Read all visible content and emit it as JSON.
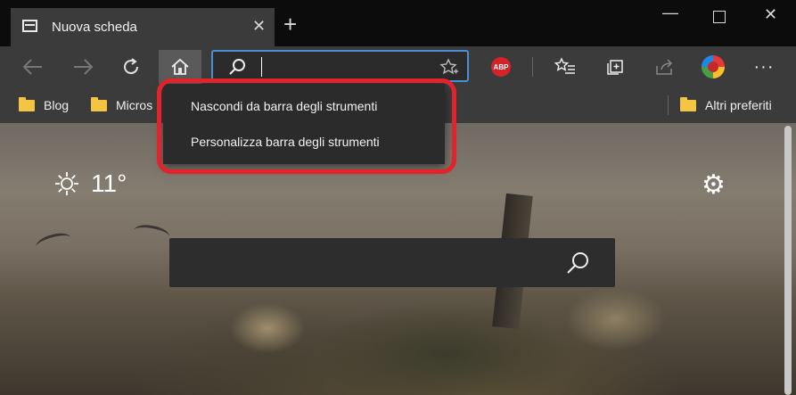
{
  "tab": {
    "title": "Nuova scheda"
  },
  "bookmarks": {
    "items": [
      {
        "label": "Blog"
      },
      {
        "label": "Micros"
      }
    ],
    "other_label": "Altri preferiti"
  },
  "extensions": {
    "abp_label": "ABP"
  },
  "weather": {
    "temperature": "11°",
    "icon": "sun-icon"
  },
  "context_menu": {
    "items": [
      {
        "label": "Nascondi da barra degli strumenti"
      },
      {
        "label": "Personalizza barra degli strumenti"
      }
    ],
    "highlight_color": "#e3232b"
  },
  "colors": {
    "address_focus": "#4a8fd6",
    "folder": "#f4c542"
  }
}
